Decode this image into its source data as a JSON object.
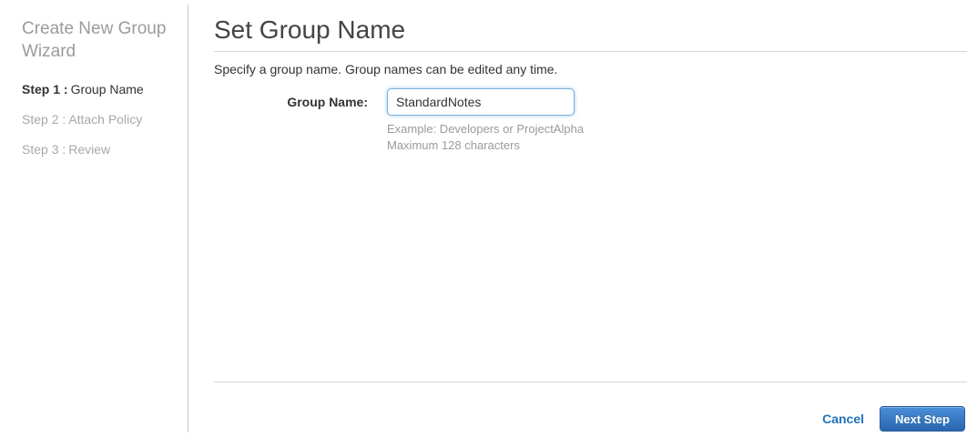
{
  "sidebar": {
    "title": "Create New Group Wizard",
    "steps": [
      {
        "prefix": "Step 1 :",
        "label": "Group Name",
        "active": true
      },
      {
        "prefix": "Step 2 :",
        "label": "Attach Policy",
        "active": false
      },
      {
        "prefix": "Step 3 :",
        "label": "Review",
        "active": false
      }
    ]
  },
  "main": {
    "title": "Set Group Name",
    "description": "Specify a group name. Group names can be edited any time.",
    "form": {
      "label": "Group Name:",
      "value": "StandardNotes",
      "hint_example": "Example: Developers or ProjectAlpha",
      "hint_max": "Maximum 128 characters"
    },
    "footer": {
      "cancel_label": "Cancel",
      "next_label": "Next Step"
    }
  },
  "colors": {
    "accent_blue": "#2272ba",
    "button_gradient_top": "#4b90d9",
    "button_gradient_bottom": "#2a65ae",
    "button_border": "#2a5d9e",
    "input_focus_border": "#7ab1de",
    "divider": "#d5d5d5",
    "muted_text": "#9b9b9b",
    "heading_text": "#444444",
    "body_text": "#333333"
  }
}
